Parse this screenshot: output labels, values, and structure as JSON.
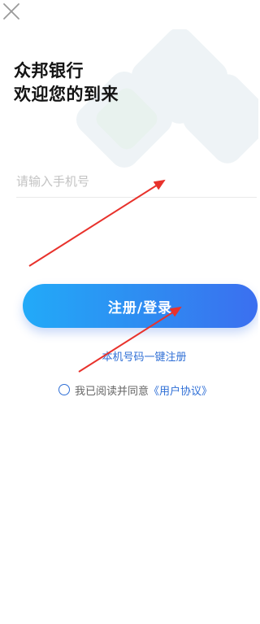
{
  "header": {
    "close_icon": "close-icon"
  },
  "welcome": {
    "line1": "众邦银行",
    "line2": "欢迎您的到来"
  },
  "login_form": {
    "phone_placeholder": "请输入手机号",
    "phone_value": "",
    "submit_label": "注册/登录",
    "onekey_register_label": "本机号码一键注册"
  },
  "agreement": {
    "checked": false,
    "text": "我已阅读并同意",
    "link_label": "《用户协议》"
  },
  "colors": {
    "accent": "#2f6fd6",
    "button_gradient_start": "#22aaf8",
    "button_gradient_end": "#3b6ff0",
    "annotation_arrow": "#e8322c"
  }
}
